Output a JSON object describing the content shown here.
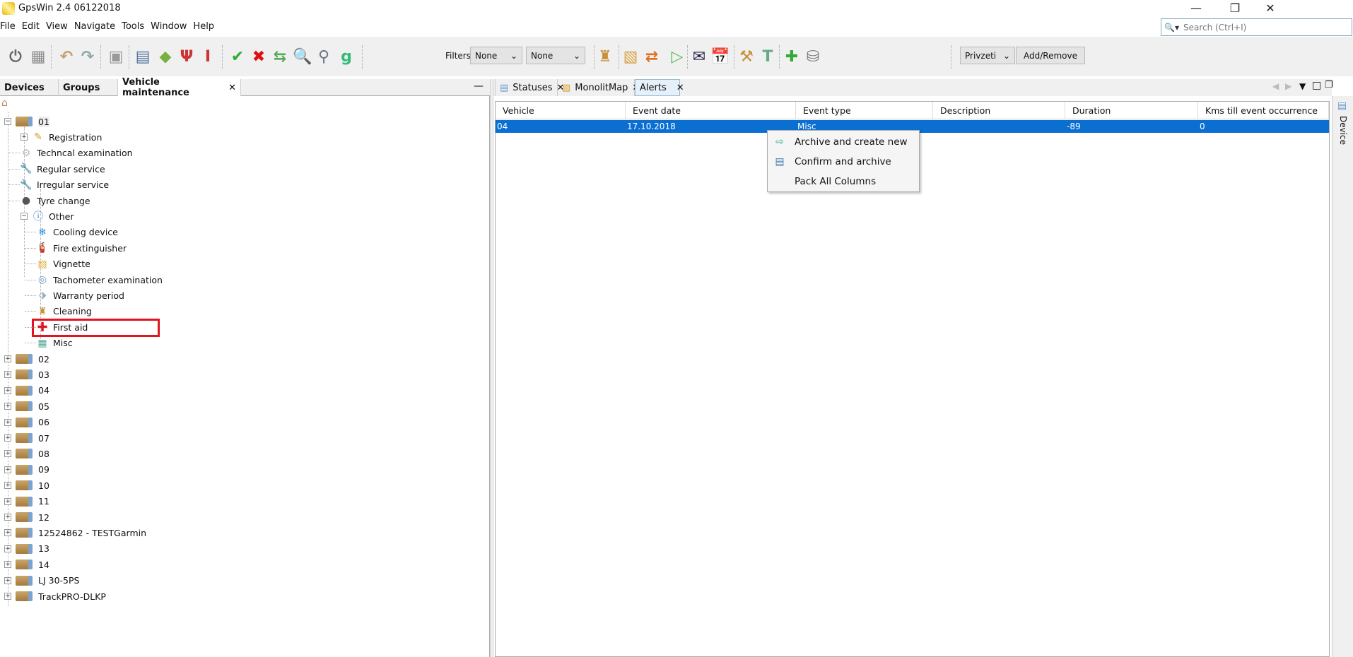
{
  "window": {
    "title": "GpsWin 2.4 06122018",
    "minimize": "—",
    "restore": "❐",
    "close": "✕"
  },
  "menu": [
    "File",
    "Edit",
    "View",
    "Navigate",
    "Tools",
    "Window",
    "Help"
  ],
  "search": {
    "placeholder": "Search (Ctrl+I)"
  },
  "toolbar": {
    "filters_label": "Filters:",
    "filter1": "None",
    "filter2": "None",
    "profile": "Privzeti",
    "add_remove": "Add/Remove"
  },
  "left_tabs": [
    {
      "label": "Devices"
    },
    {
      "label": "Groups"
    },
    {
      "label": "Vehicle maintenance",
      "active": true
    }
  ],
  "right_tabs": [
    {
      "label": "Statuses"
    },
    {
      "label": "MonolitMap"
    },
    {
      "label": "Alerts",
      "active": true
    }
  ],
  "tree": {
    "root_vehicle": "01",
    "children": [
      "Registration",
      "Techncal examination",
      "Regular service",
      "Irregular service",
      "Tyre change",
      "Other"
    ],
    "other_children": [
      "Cooling device",
      "Fire extinguisher",
      "Vignette",
      "Tachometer examination",
      "Warranty period",
      "Cleaning",
      "First aid",
      "Misc"
    ],
    "highlighted": "First aid",
    "vehicles": [
      "02",
      "03",
      "04",
      "05",
      "06",
      "07",
      "08",
      "09",
      "10",
      "11",
      "12",
      "12524862 - TESTGarmin",
      "13",
      "14",
      "LJ 30-5PS",
      "TrackPRO-DLKP"
    ]
  },
  "table": {
    "columns": [
      "Vehicle",
      "Event date",
      "Event type",
      "Description",
      "Duration",
      "Kms till event occurrence"
    ],
    "rows": [
      [
        "04",
        "17.10.2018",
        "Misc",
        "",
        "-89",
        "0"
      ]
    ]
  },
  "context_menu": [
    "Archive and create new",
    "Confirm and archive",
    "Pack All Columns"
  ],
  "side_panel": {
    "label": "Device"
  },
  "colors": {
    "selection": "#0a6fd1",
    "highlight_box": "#e0151f"
  }
}
